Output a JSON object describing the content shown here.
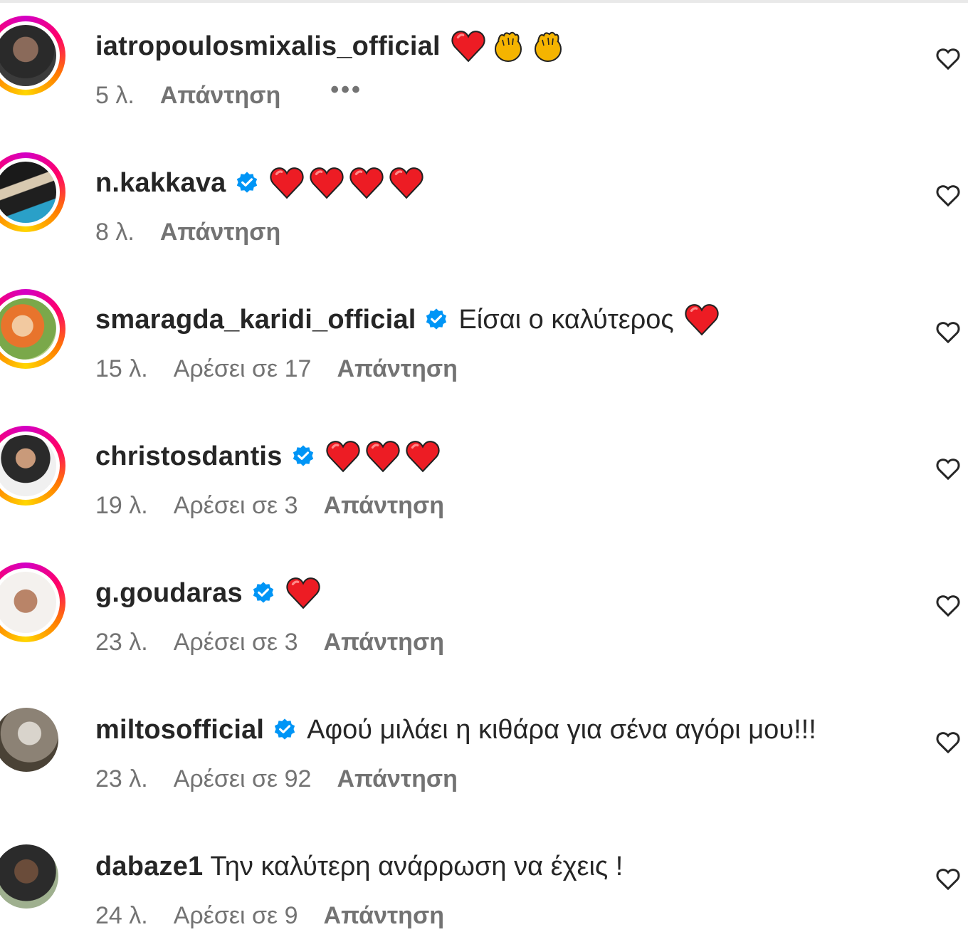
{
  "reply_label": "Απάντηση",
  "comments": [
    {
      "username": "iatropoulosmixalis_official",
      "verified": false,
      "text": "",
      "emojis": [
        "red-heart",
        "clap",
        "clap"
      ],
      "time": "5 λ.",
      "likes": "",
      "more": "•••",
      "story_ring": true
    },
    {
      "username": "n.kakkava",
      "verified": true,
      "text": "",
      "emojis": [
        "red-heart",
        "red-heart",
        "red-heart",
        "red-heart"
      ],
      "time": "8 λ.",
      "likes": "",
      "more": "",
      "story_ring": true
    },
    {
      "username": "smaragda_karidi_official",
      "verified": true,
      "text": "Είσαι ο καλύτερος",
      "emojis": [
        "red-heart"
      ],
      "time": "15 λ.",
      "likes": "Αρέσει σε 17",
      "more": "",
      "story_ring": true
    },
    {
      "username": "christosdantis",
      "verified": true,
      "text": "",
      "emojis": [
        "red-heart",
        "red-heart",
        "red-heart"
      ],
      "time": "19 λ.",
      "likes": "Αρέσει σε 3",
      "more": "",
      "story_ring": true
    },
    {
      "username": "g.goudaras",
      "verified": true,
      "text": "",
      "emojis": [
        "red-heart"
      ],
      "time": "23 λ.",
      "likes": "Αρέσει σε 3",
      "more": "",
      "story_ring": true
    },
    {
      "username": "miltosofficial",
      "verified": true,
      "text": "Αφού μιλάει η κιθάρα για σένα αγόρι μου!!!",
      "emojis": [],
      "time": "23 λ.",
      "likes": "Αρέσει σε 92",
      "more": "",
      "story_ring": false
    },
    {
      "username": "dabaze1",
      "verified": false,
      "text": "Την καλύτερη ανάρρωση να έχεις !",
      "emojis": [],
      "time": "24 λ.",
      "likes": "Αρέσει σε 9",
      "more": "",
      "story_ring": false
    }
  ],
  "colors": {
    "text": "#262626",
    "meta": "#737373",
    "verified": "#0095f6",
    "heart": "#ed1c24"
  }
}
